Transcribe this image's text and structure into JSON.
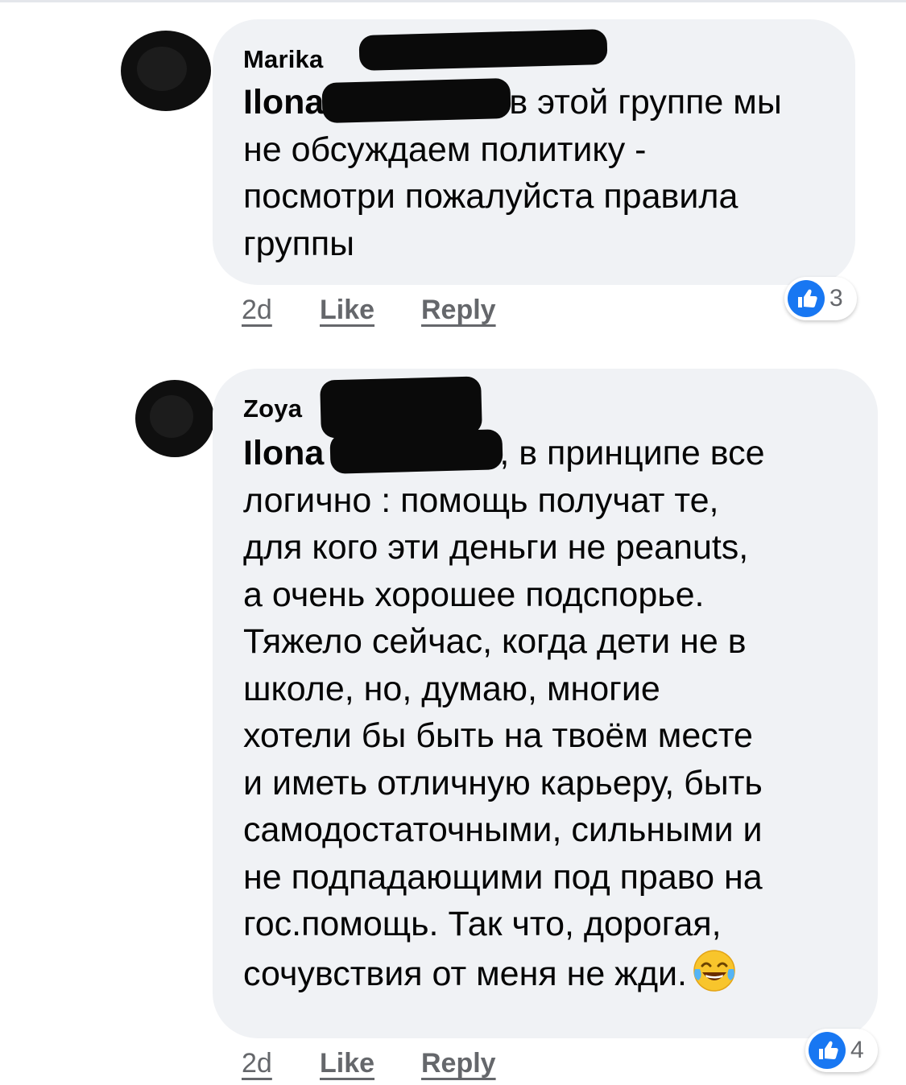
{
  "comments": [
    {
      "author": "Marika",
      "mention": "Ilona",
      "text_after_mention": "в этой группе мы\nне обсуждаем политику -\nпосмотри пожалуйста правила\nгруппы",
      "time": "2d",
      "like_label": "Like",
      "reply_label": "Reply",
      "reaction_icon": "thumbs-up-icon",
      "reaction_count": "3"
    },
    {
      "author": "Zoya",
      "mention": "Ilona",
      "text_after_mention": ", в принципе все\nлогично : помощь получат те,\nдля кого эти деньги не peanuts,\nа очень хорошее подспорье.\nТяжело сейчас, когда дети не в\nшколе, но, думаю, многие\nхотели бы быть на твоём месте\nи иметь отличную карьеру, быть\nсамодостаточными, сильными и\nне подпадающими  под право на\nгос.помощь. Так что, дорогая,\nсочувствия от меня не жди.",
      "emoji": "face-with-tears-of-joy-icon",
      "time": "2d",
      "like_label": "Like",
      "reply_label": "Reply",
      "reaction_icon": "thumbs-up-icon",
      "reaction_count": "4"
    }
  ],
  "colors": {
    "bubble": "#f0f2f5",
    "text": "#050505",
    "meta": "#65676b",
    "like_blue": "#1877f2"
  }
}
